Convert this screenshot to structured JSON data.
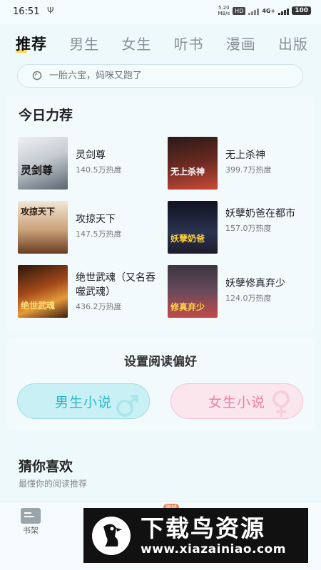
{
  "status_bar": {
    "time": "16:51",
    "extra": "Ψ",
    "net_speed": "5.20",
    "net_unit": "MB/s",
    "hd": "HD",
    "network": "4G+",
    "battery": "100"
  },
  "tabs": [
    {
      "label": "推荐",
      "active": true
    },
    {
      "label": "男生",
      "active": false
    },
    {
      "label": "女生",
      "active": false
    },
    {
      "label": "听书",
      "active": false
    },
    {
      "label": "漫画",
      "active": false
    },
    {
      "label": "出版",
      "active": false
    }
  ],
  "search": {
    "placeholder": "一胎六宝，妈咪又跑了"
  },
  "today": {
    "title": "今日力荐",
    "books": [
      {
        "title": "灵剑尊",
        "heat": "140.5万热度",
        "cover_text": "灵剑尊",
        "cover_colors": [
          "#e9ecef",
          "#7d8a95"
        ]
      },
      {
        "title": "无上杀神",
        "heat": "399.7万热度",
        "cover_text": "无上杀神",
        "cover_colors": [
          "#3a2420",
          "#b23a2f"
        ]
      },
      {
        "title": "攻掠天下",
        "heat": "147.5万热度",
        "cover_text": "攻掠天下",
        "cover_colors": [
          "#e9d9c3",
          "#8a5a3a"
        ]
      },
      {
        "title": "妖孽奶爸在都市",
        "heat": "157.0万热度",
        "cover_text": "妖孽奶爸",
        "cover_colors": [
          "#1a1f2e",
          "#3d4560"
        ]
      },
      {
        "title": "绝世武魂（又名吞噬武魂）",
        "heat": "436.2万热度",
        "cover_text": "绝世武魂",
        "cover_colors": [
          "#3a1e10",
          "#d2782a"
        ]
      },
      {
        "title": "妖孽修真弃少",
        "heat": "124.0万热度",
        "cover_text": "修真弃少",
        "cover_colors": [
          "#2a1f2a",
          "#b84a5a"
        ]
      }
    ]
  },
  "preference": {
    "title": "设置阅读偏好",
    "male_label": "男生小说",
    "female_label": "女生小说",
    "male_color": "#2fb8c6",
    "female_color": "#ee7fa5"
  },
  "guess": {
    "title": "猜你喜欢",
    "subtitle": "最懂你的阅读推荐"
  },
  "bottom_nav": {
    "bookshelf_label": "书架",
    "badge": "赚钱"
  },
  "watermark": {
    "brand": "下载鸟资源",
    "url": "www.xiazainiao.com"
  }
}
